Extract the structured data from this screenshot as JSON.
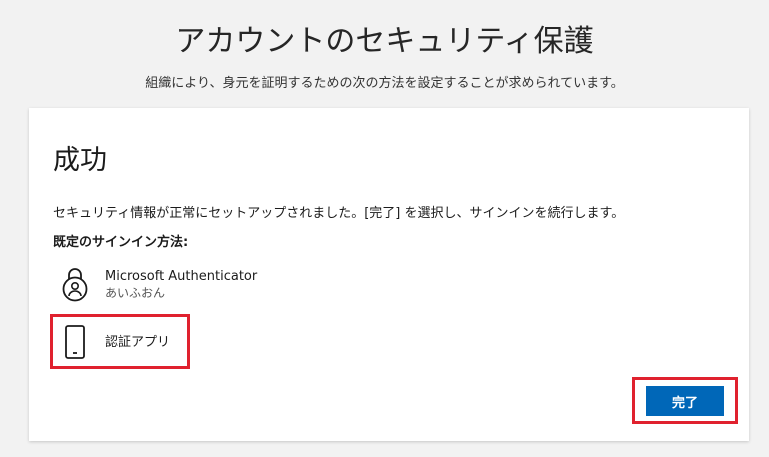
{
  "page": {
    "title": "アカウントのセキュリティ保護",
    "subtitle": "組織により、身元を証明するための次の方法を設定することが求められています。"
  },
  "card": {
    "title": "成功",
    "message": "セキュリティ情報が正常にセットアップされました。[完了] を選択し、サインインを続行します。",
    "default_method_label": "既定のサインイン方法:",
    "methods": [
      {
        "icon": "authenticator-lock-icon",
        "name": "Microsoft Authenticator",
        "detail": "あいふおん"
      },
      {
        "icon": "phone-icon",
        "name": "認証アプリ"
      }
    ],
    "done_label": "完了"
  },
  "colors": {
    "accent": "#0067b8",
    "highlight": "#e0212e",
    "background": "#f2f2f2"
  }
}
